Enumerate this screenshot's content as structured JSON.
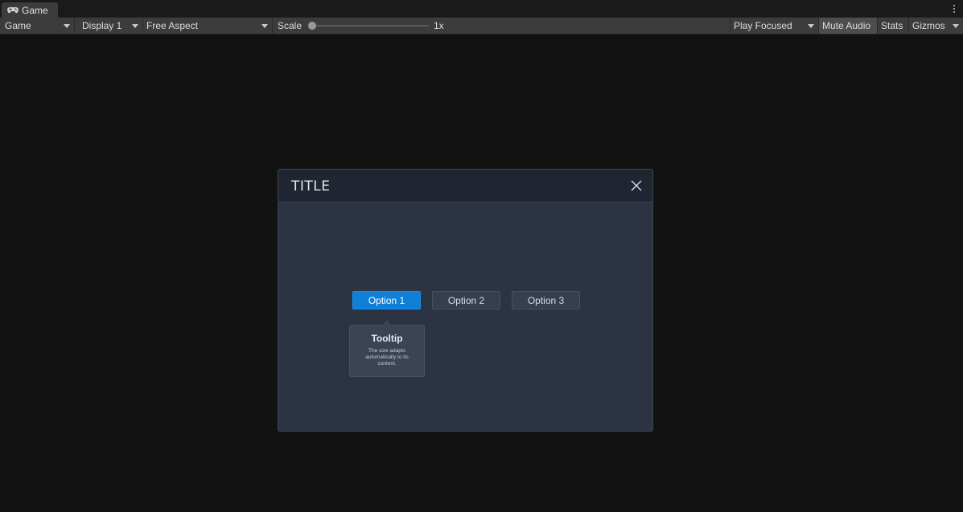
{
  "tab": {
    "label": "Game",
    "icon": "gamepad-icon"
  },
  "toolbar": {
    "view_select": "Game",
    "display_select": "Display 1",
    "aspect_select": "Free Aspect",
    "scale_label": "Scale",
    "scale_value": "1x",
    "scale_fraction": 0.0,
    "play_mode_select": "Play Focused",
    "mute_audio": "Mute Audio",
    "stats": "Stats",
    "gizmos": "Gizmos"
  },
  "modal": {
    "title": "TITLE",
    "close_icon": "close-icon",
    "options": [
      {
        "label": "Option 1",
        "active": true
      },
      {
        "label": "Option 2",
        "active": false
      },
      {
        "label": "Option 3",
        "active": false
      }
    ],
    "tooltip": {
      "title": "Tooltip",
      "body": "The size adapts automatically to its content."
    }
  },
  "colors": {
    "accent": "#0f7fd8",
    "panel": "#2c3443",
    "header": "#1f2631",
    "toolbar": "#3c3c3c",
    "background": "#121212"
  }
}
